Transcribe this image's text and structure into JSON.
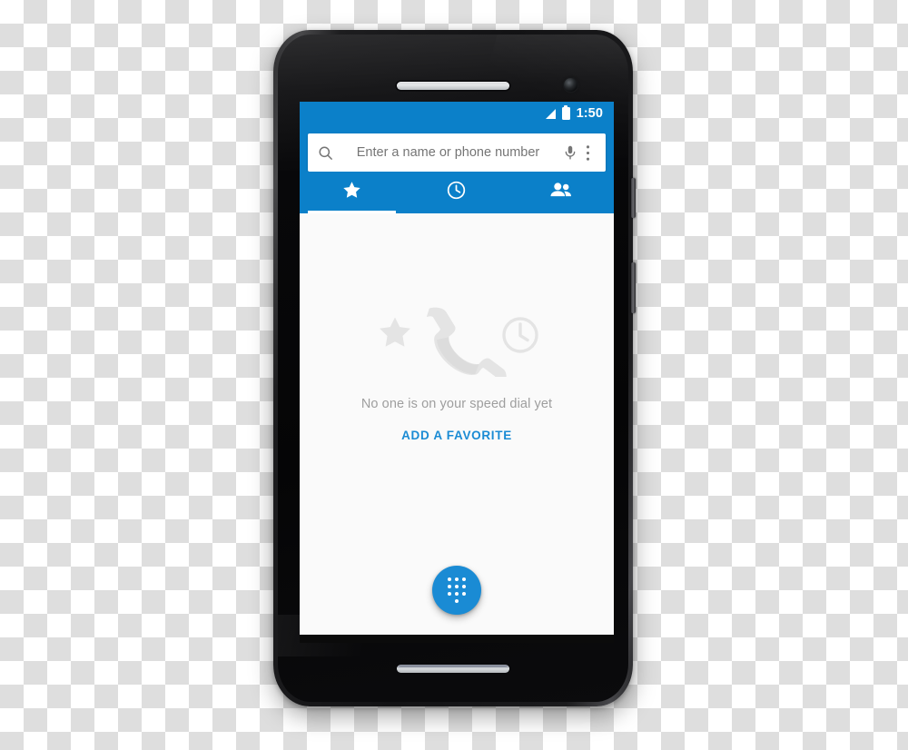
{
  "device": {
    "name": "android-smartphone-mockup",
    "earpiece_icon": "speaker-grille-icon",
    "camera_icon": "front-camera-icon",
    "power_button": "power-button",
    "volume_button": "volume-button"
  },
  "status_bar": {
    "time": "1:50",
    "signal_icon": "signal-bars-icon",
    "battery_icon": "battery-full-icon"
  },
  "search": {
    "placeholder": "Enter a name or phone number",
    "value": "",
    "search_icon": "search-icon",
    "voice_icon": "microphone-icon",
    "overflow_icon": "more-vert-icon"
  },
  "tabs": [
    {
      "id": "favorites",
      "icon": "star-icon",
      "label": "Favorites",
      "active": true
    },
    {
      "id": "recents",
      "icon": "clock-icon",
      "label": "Recents",
      "active": false
    },
    {
      "id": "contacts",
      "icon": "people-icon",
      "label": "Contacts",
      "active": false
    }
  ],
  "empty_state": {
    "art_icons": [
      "star-icon",
      "phone-handset-icon",
      "clock-icon"
    ],
    "title": "No one is on your speed dial yet",
    "action_label": "ADD A FAVORITE"
  },
  "fab": {
    "icon": "dialpad-icon",
    "label": "Open dialpad"
  },
  "nav_bar": {
    "back_icon": "back-triangle-icon",
    "home_icon": "home-circle-icon",
    "recents_icon": "recents-square-icon"
  },
  "colors": {
    "primary": "#0b80c9",
    "accent": "#1a8bd4",
    "content_bg": "#fafafa",
    "placeholder_text": "#757575",
    "empty_text": "#9e9e9e",
    "empty_art": "#e4e4e4",
    "nav_bg": "#0b0b0b"
  }
}
